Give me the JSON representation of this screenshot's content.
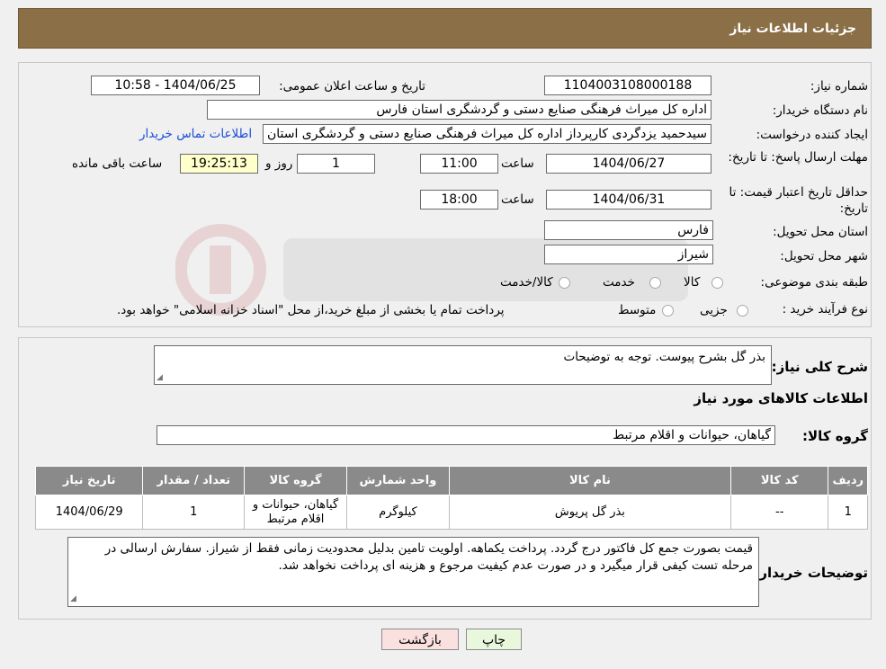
{
  "header": {
    "title": "جزئیات اطلاعات نیاز"
  },
  "form": {
    "need_number_label": "شماره نیاز:",
    "need_number": "1104003108000188",
    "announce_label": "تاریخ و ساعت اعلان عمومی:",
    "announce_value": "1404/06/25 - 10:58",
    "buyer_org_label": "نام دستگاه خریدار:",
    "buyer_org": "اداره کل میراث فرهنگی  صنایع دستی و گردشگری استان فارس",
    "creator_label": "ایجاد کننده درخواست:",
    "creator": "سیدحمید یزدگردی کارپرداز اداره کل میراث فرهنگی  صنایع دستی و گردشگری استان فارس",
    "contact_link": "اطلاعات تماس خریدار",
    "reply_deadline_label": "مهلت ارسال پاسخ: تا تاریخ:",
    "reply_date": "1404/06/27",
    "time_label": "ساعت",
    "reply_time": "11:00",
    "days": "1",
    "day_and_label": "روز و",
    "remaining": "19:25:13",
    "remaining_label": "ساعت باقی مانده",
    "price_validity_label": "حداقل تاریخ اعتبار قیمت: تا تاریخ:",
    "price_date": "1404/06/31",
    "price_time": "18:00",
    "province_label": "استان محل تحویل:",
    "province": "فارس",
    "city_label": "شهر محل تحویل:",
    "city": "شیراز",
    "category_label": "طبقه بندی موضوعی:",
    "category_options": [
      "کالا",
      "خدمت",
      "کالا/خدمت"
    ],
    "process_label": "نوع فرآیند خرید :",
    "process_options": [
      "جزیی",
      "متوسط"
    ],
    "process_note": "پرداخت تمام یا بخشی از مبلغ خرید،از محل \"اسناد خزانه اسلامی\" خواهد بود."
  },
  "summary": {
    "desc_label": "شرح کلی نیاز:",
    "desc": "بذر گل بشرح پیوست. توجه به توضیحات",
    "goods_title": "اطلاعات کالاهای مورد نیاز",
    "group_label": "گروه کالا:",
    "group": "گیاهان، حیوانات و اقلام مرتبط"
  },
  "table": {
    "headers": [
      "ردیف",
      "کد کالا",
      "نام کالا",
      "واحد شمارش",
      "گروه کالا",
      "تعداد / مقدار",
      "تاریخ نیاز"
    ],
    "rows": [
      [
        "1",
        "--",
        "بذر گل پریوش",
        "کیلوگرم",
        "گیاهان، حیوانات و اقلام مرتبط",
        "1",
        "1404/06/29"
      ]
    ]
  },
  "buyer_notes": {
    "label": "توضیحات خریدار:",
    "text": "قیمت بصورت جمع کل فاکتور درج گردد. پرداخت یکماهه. اولویت تامین بدلیل محدودیت زمانی فقط از شیراز. سفارش ارسالی در مرحله تست کیفی قرار میگیرد و در صورت عدم کیفیت مرجوع و هزینه ای پرداخت نخواهد شد."
  },
  "buttons": {
    "print": "چاپ",
    "back": "بازگشت"
  },
  "colors": {
    "header": "#8b6f47",
    "print_btn": "#e9f7dc",
    "back_btn": "#fbe0e0"
  }
}
